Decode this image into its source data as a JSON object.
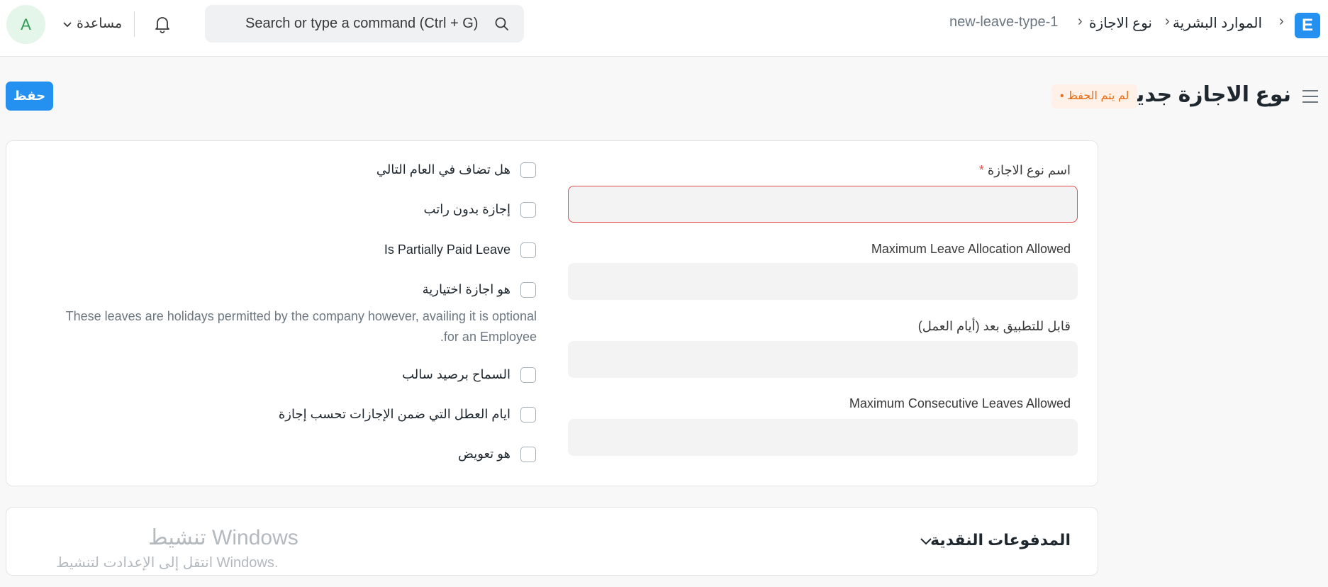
{
  "app": {
    "logo_letter": "E"
  },
  "breadcrumbs": [
    "الموارد البشرية",
    "نوع الاجازة",
    "new-leave-type-1"
  ],
  "search": {
    "placeholder": "Search or type a command (Ctrl + G)"
  },
  "help": {
    "label": "مساعدة"
  },
  "user": {
    "avatar_letter": "A"
  },
  "page": {
    "title": "نوع الاجازة جديد",
    "status_badge": "لم يتم الحفظ",
    "save_label": "حفظ"
  },
  "form": {
    "fields": [
      {
        "label": "اسم نوع الاجازة",
        "required_mark": "*",
        "value": ""
      },
      {
        "label": "Maximum Leave Allocation Allowed",
        "value": ""
      },
      {
        "label": "قابل للتطبيق بعد (أيام العمل)",
        "value": ""
      },
      {
        "label": "Maximum Consecutive Leaves Allowed",
        "value": ""
      }
    ],
    "checkboxes": [
      {
        "label": "هل تضاف في العام التالي",
        "checked": false
      },
      {
        "label": "إجازة بدون راتب",
        "checked": false
      },
      {
        "label": "Is Partially Paid Leave",
        "checked": false
      },
      {
        "label": "هو اجازة اختيارية",
        "checked": false
      },
      {
        "label": "السماح برصيد سالب",
        "checked": false
      },
      {
        "label": "ايام العطل التي ضمن الإجازات تحسب إجازة",
        "checked": false
      },
      {
        "label": "هو تعويض",
        "checked": false
      }
    ],
    "optional_desc_line1": "These leaves are holidays permitted by the company however, availing it is optional",
    "optional_desc_line2": ".for an Employee"
  },
  "sections": {
    "encashment_title": "المدفوعات النقدية"
  },
  "watermark": {
    "title": "تنشيط Windows",
    "subtitle": "انتقل إلى الإعدادت لتنشيط Windows."
  },
  "colors": {
    "primary": "#2490ef",
    "warning": "#e86c13",
    "error": "#e24c4c"
  }
}
